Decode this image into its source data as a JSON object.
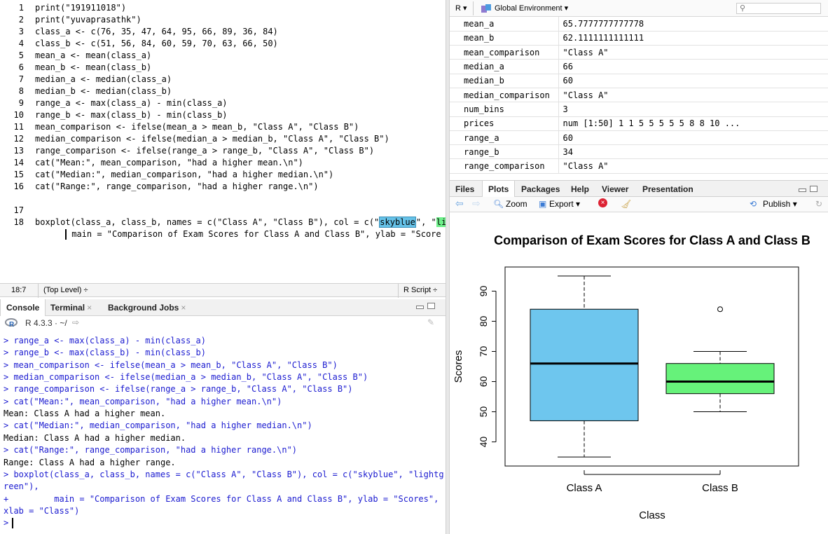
{
  "editor": {
    "lines": [
      {
        "n": "1",
        "text": "print(\"191911018\")"
      },
      {
        "n": "2",
        "text": "print(\"yuvaprasathk\")"
      },
      {
        "n": "3",
        "text": "class_a <- c(76, 35, 47, 64, 95, 66, 89, 36, 84)"
      },
      {
        "n": "4",
        "text": "class_b <- c(51, 56, 84, 60, 59, 70, 63, 66, 50)"
      },
      {
        "n": "5",
        "text": "mean_a <- mean(class_a)"
      },
      {
        "n": "6",
        "text": "mean_b <- mean(class_b)"
      },
      {
        "n": "7",
        "text": "median_a <- median(class_a)"
      },
      {
        "n": "8",
        "text": "median_b <- median(class_b)"
      },
      {
        "n": "9",
        "text": "range_a <- max(class_a) - min(class_a)"
      },
      {
        "n": "10",
        "text": "range_b <- max(class_b) - min(class_b)"
      },
      {
        "n": "11",
        "text": "mean_comparison <- ifelse(mean_a > mean_b, \"Class A\", \"Class B\")"
      },
      {
        "n": "12",
        "text": "median_comparison <- ifelse(median_a > median_b, \"Class A\", \"Class B\")"
      },
      {
        "n": "13",
        "text": "range_comparison <- ifelse(range_a > range_b, \"Class A\", \"Class B\")"
      },
      {
        "n": "14",
        "text": "cat(\"Mean:\", mean_comparison, \"had a higher mean.\\n\")"
      },
      {
        "n": "15",
        "text": "cat(\"Median:\", median_comparison, \"had a higher median.\\n\")"
      },
      {
        "n": "16",
        "text": "cat(\"Range:\", range_comparison, \"had a higher range.\\n\")"
      }
    ],
    "line17": {
      "n": "17",
      "pre": "boxplot(class_a, class_b, names = c(\"Class A\", \"Class B\"), col = c(\"",
      "hl1": "skyblue",
      "mid": "\", \"",
      "hl2": "li"
    },
    "line18": {
      "n": "18",
      "text": "main = \"Comparison of Exam Scores for Class A and Class B\", ylab = \"Score"
    },
    "status": {
      "position": "18:7",
      "scope": "(Top Level) ÷",
      "filetype": "R Script ÷"
    }
  },
  "console": {
    "tabs": [
      {
        "label": "Console",
        "close": ""
      },
      {
        "label": "Terminal",
        "close": "×"
      },
      {
        "label": "Background Jobs",
        "close": "×"
      }
    ],
    "r_version": "R 4.3.3 · ~/",
    "lines": [
      {
        "kind": "cmd",
        "text": "> range_a <- max(class_a) - min(class_a)"
      },
      {
        "kind": "cmd",
        "text": "> range_b <- max(class_b) - min(class_b)"
      },
      {
        "kind": "cmd",
        "text": "> mean_comparison <- ifelse(mean_a > mean_b, \"Class A\", \"Class B\")"
      },
      {
        "kind": "cmd",
        "text": "> median_comparison <- ifelse(median_a > median_b, \"Class A\", \"Class B\")"
      },
      {
        "kind": "cmd",
        "text": "> range_comparison <- ifelse(range_a > range_b, \"Class A\", \"Class B\")"
      },
      {
        "kind": "cmd",
        "text": "> cat(\"Mean:\", mean_comparison, \"had a higher mean.\\n\")"
      },
      {
        "kind": "out",
        "text": "Mean: Class A had a higher mean."
      },
      {
        "kind": "cmd",
        "text": "> cat(\"Median:\", median_comparison, \"had a higher median.\\n\")"
      },
      {
        "kind": "out",
        "text": "Median: Class A had a higher median."
      },
      {
        "kind": "cmd",
        "text": "> cat(\"Range:\", range_comparison, \"had a higher range.\\n\")"
      },
      {
        "kind": "out",
        "text": "Range: Class A had a higher range."
      },
      {
        "kind": "cmd",
        "text": "> boxplot(class_a, class_b, names = c(\"Class A\", \"Class B\"), col = c(\"skyblue\", \"lightg"
      },
      {
        "kind": "cmd",
        "text": "reen\"),"
      },
      {
        "kind": "cmd",
        "text": "+         main = \"Comparison of Exam Scores for Class A and Class B\", ylab = \"Scores\","
      },
      {
        "kind": "cmd",
        "text": "xlab = \"Class\")"
      },
      {
        "kind": "cmd",
        "text": "> "
      }
    ]
  },
  "environment": {
    "language": "R ▾",
    "scope": "Global Environment ▾",
    "search_placeholder": "",
    "rows": [
      {
        "name": "mean_a",
        "value": "65.7777777777778"
      },
      {
        "name": "mean_b",
        "value": "62.1111111111111"
      },
      {
        "name": "mean_comparison",
        "value": "\"Class A\""
      },
      {
        "name": "median_a",
        "value": "66"
      },
      {
        "name": "median_b",
        "value": "60"
      },
      {
        "name": "median_comparison",
        "value": "\"Class A\""
      },
      {
        "name": "num_bins",
        "value": "3"
      },
      {
        "name": "prices",
        "value": "num [1:50] 1 1 5 5 5 5 5 8 8 10 ..."
      },
      {
        "name": "range_a",
        "value": "60"
      },
      {
        "name": "range_b",
        "value": "34"
      },
      {
        "name": "range_comparison",
        "value": "\"Class A\""
      }
    ]
  },
  "files_pane": {
    "tabs": [
      "Files",
      "Plots",
      "Packages",
      "Help",
      "Viewer",
      "Presentation"
    ],
    "active_tab": "Plots",
    "toolbar": {
      "zoom": "Zoom",
      "export": "Export ▾",
      "publish": "Publish ▾"
    }
  },
  "colors": {
    "class_a_box": "#6ec6ee",
    "class_b_box": "#66f27a"
  },
  "chart_data": {
    "type": "boxplot",
    "title": "Comparison of Exam Scores for Class A and Class B",
    "xlabel": "Class",
    "ylabel": "Scores",
    "ylim": [
      32,
      98
    ],
    "yticks": [
      40,
      50,
      60,
      70,
      80,
      90
    ],
    "categories": [
      "Class A",
      "Class B"
    ],
    "boxes": [
      {
        "name": "Class A",
        "min": 35,
        "q1": 47,
        "median": 66,
        "q3": 84,
        "max": 95,
        "outliers": []
      },
      {
        "name": "Class B",
        "min": 50,
        "q1": 56,
        "median": 60,
        "q3": 66,
        "max": 70,
        "outliers": [
          84
        ]
      }
    ]
  }
}
